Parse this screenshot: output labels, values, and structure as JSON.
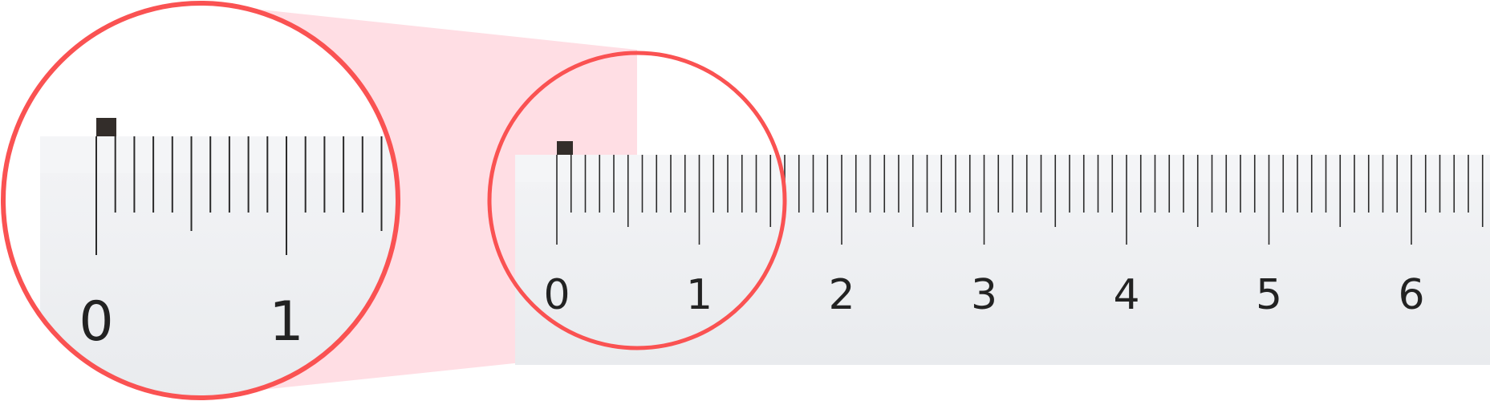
{
  "ruler": {
    "tick_labels": [
      "0",
      "1",
      "2",
      "3",
      "4",
      "5",
      "6"
    ],
    "minor_divisions_per_unit": 10,
    "visible_units": 6.5
  },
  "magnifier": {
    "tick_labels": [
      "0",
      "1"
    ],
    "visible_units": 1.5,
    "minor_divisions_per_unit": 10
  },
  "colors": {
    "highlight_ring": "#fa5252",
    "zoom_cone": "#ffdee4",
    "ruler_body": "#eceef1",
    "ruler_top": "#f4f5f7",
    "tick": "#2a2a2a",
    "label": "#222222",
    "start_marker": "#332d2a"
  }
}
